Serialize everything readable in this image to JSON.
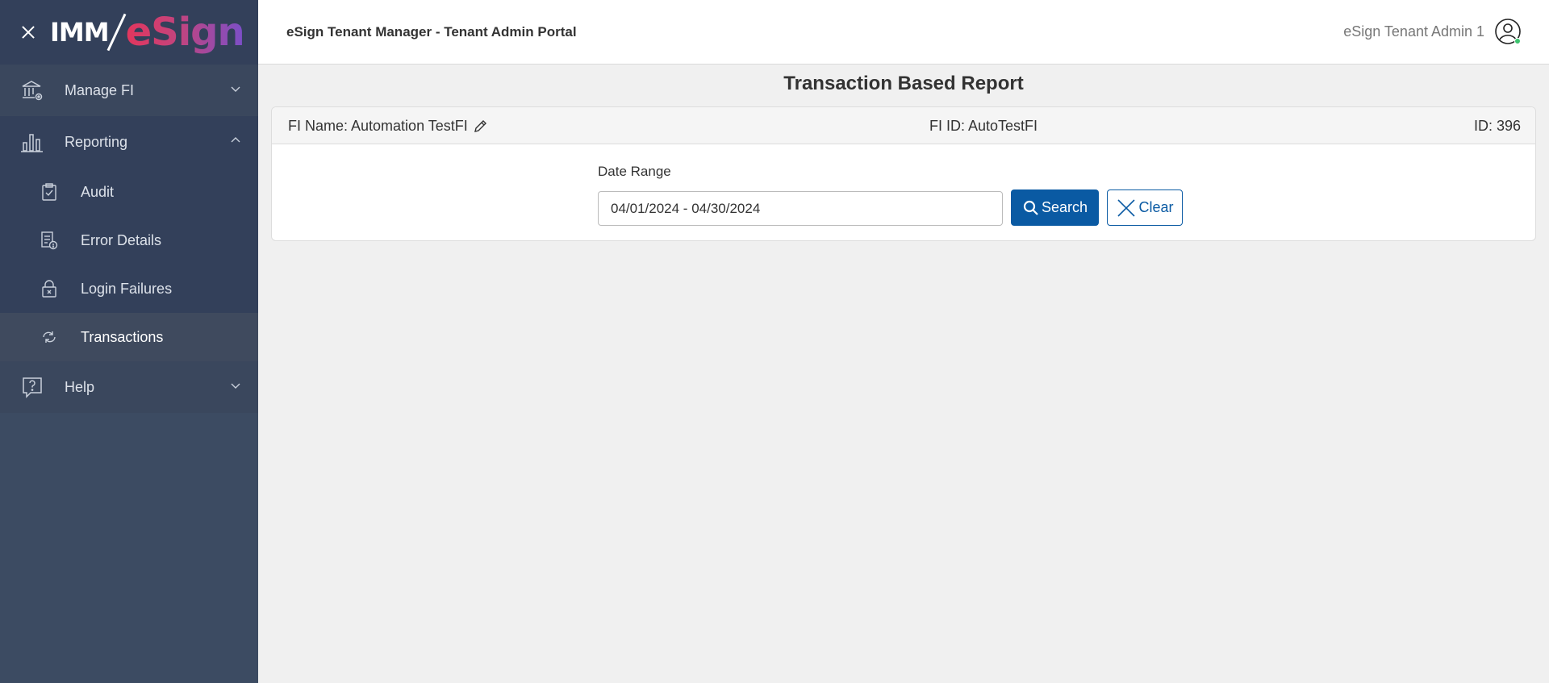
{
  "brand": {
    "logo_imm": "IMM",
    "logo_esign": "eSign",
    "close_icon": "close-icon"
  },
  "sidebar": {
    "manage_fi": "Manage FI",
    "reporting": "Reporting",
    "sub_items": [
      {
        "label": "Audit",
        "icon": "clipboard-check-icon"
      },
      {
        "label": "Error Details",
        "icon": "report-error-icon"
      },
      {
        "label": "Login Failures",
        "icon": "lock-x-icon"
      },
      {
        "label": "Transactions",
        "icon": "refresh-cycle-icon"
      }
    ],
    "help": "Help",
    "active": "Transactions"
  },
  "header": {
    "app_title": "eSign Tenant Manager - Tenant Admin Portal",
    "user_name": "eSign Tenant Admin 1"
  },
  "main": {
    "page_title": "Transaction Based Report",
    "fi_name": "FI Name: Automation TestFI",
    "fi_id": "FI ID: AutoTestFI",
    "record_id": "ID: 396",
    "date_range_label": "Date Range",
    "date_range_value": "04/01/2024 - 04/30/2024",
    "search_label": "Search",
    "clear_label": "Clear"
  },
  "colors": {
    "sidebar_bg": "#3c4b62",
    "primary": "#0a5aa3",
    "online": "#3cc46e"
  }
}
